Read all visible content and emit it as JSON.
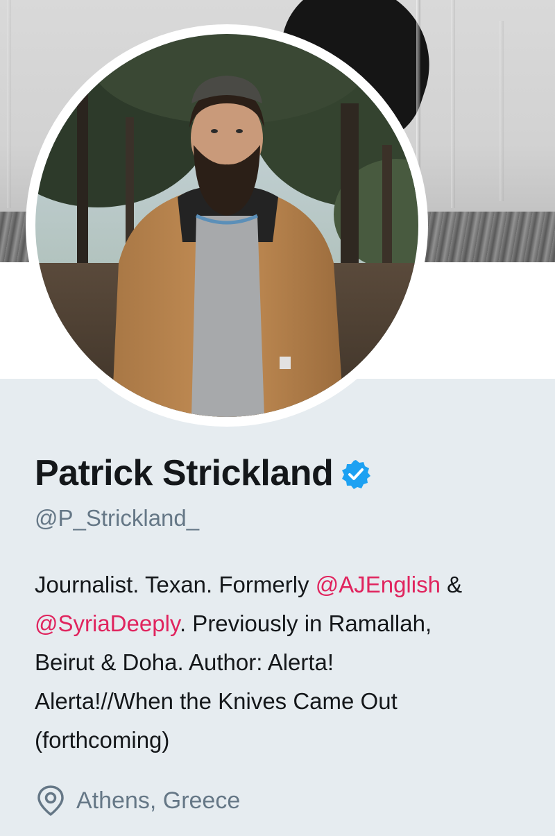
{
  "profile": {
    "display_name": "Patrick Strickland",
    "verified": true,
    "handle": "@P_Strickland_",
    "bio": {
      "line1": {
        "t1": "Journalist. Texan. Formerly ",
        "m1": "@AJEnglish",
        "t2": " &"
      },
      "line2": {
        "m1": "@SyriaDeeply",
        "t1": ". Previously in Ramallah,"
      },
      "line3": "Beirut & Doha. Author: Alerta!",
      "line4": "Alerta!//When the Knives Came Out",
      "line5": "(forthcoming)"
    },
    "location": "Athens, Greece"
  },
  "icons": {
    "verified": "verified-badge-icon",
    "location": "location-pin-icon"
  },
  "colors": {
    "mention": "#e0245e",
    "verified_blue": "#1da1f2",
    "secondary_text": "#657786",
    "primary_text": "#14171a",
    "card_background": "#e6ecf0"
  }
}
